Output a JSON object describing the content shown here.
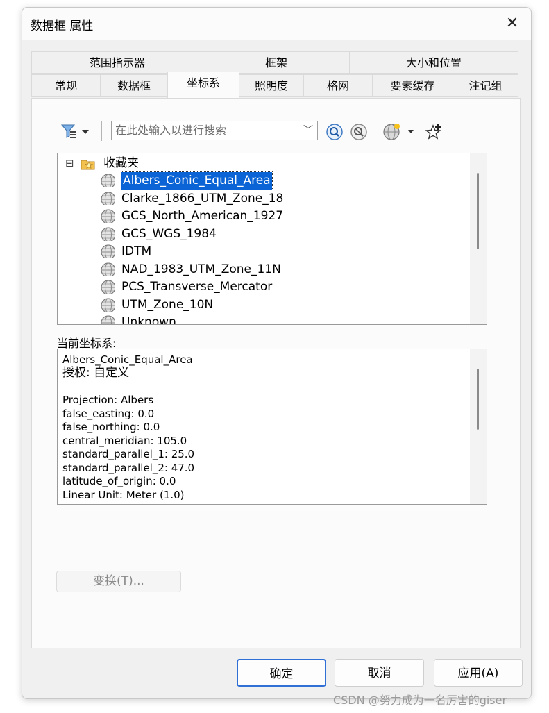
{
  "window": {
    "title": "数据框 属性",
    "close_glyph": "✕"
  },
  "tabs_row1": [
    {
      "label": "范围指示器"
    },
    {
      "label": "框架"
    },
    {
      "label": "大小和位置"
    }
  ],
  "tabs_row2": [
    {
      "label": "常规"
    },
    {
      "label": "数据框"
    },
    {
      "label": "坐标系",
      "active": true
    },
    {
      "label": "照明度"
    },
    {
      "label": "格网"
    },
    {
      "label": "要素缓存"
    },
    {
      "label": "注记组"
    }
  ],
  "toolbar": {
    "filter_icon": "filter-icon",
    "search_placeholder": "在此处输入以进行搜索",
    "search_icon": "search-icon",
    "clear_search_icon": "clear-search-icon",
    "globe_icon": "add-coordinate-system-icon",
    "favorite_icon": "add-to-favorites-icon"
  },
  "tree": {
    "folder_label": "收藏夹",
    "expand_glyph": "⊟",
    "items": [
      "Albers_Conic_Equal_Area",
      "Clarke_1866_UTM_Zone_18",
      "GCS_North_American_1927",
      "GCS_WGS_1984",
      "IDTM",
      "NAD_1983_UTM_Zone_11N",
      "PCS_Transverse_Mercator",
      "UTM_Zone_10N",
      "Unknown"
    ],
    "selected_index": 0
  },
  "current": {
    "label": "当前坐标系:",
    "name": "Albers_Conic_Equal_Area",
    "authority": "授权: 自定义",
    "lines": [
      "Projection: Albers",
      "false_easting: 0.0",
      "false_northing: 0.0",
      "central_meridian: 105.0",
      "standard_parallel_1: 25.0",
      "standard_parallel_2: 47.0",
      "latitude_of_origin: 0.0",
      "Linear Unit: Meter (1.0)"
    ]
  },
  "transform_button": "变换(T)...",
  "buttons": {
    "ok": "确定",
    "cancel": "取消",
    "apply": "应用(A)"
  },
  "watermark": "CSDN @努力成为一名厉害的giser",
  "colors": {
    "selection": "#0a64d6",
    "accent": "#2f6fd6"
  }
}
